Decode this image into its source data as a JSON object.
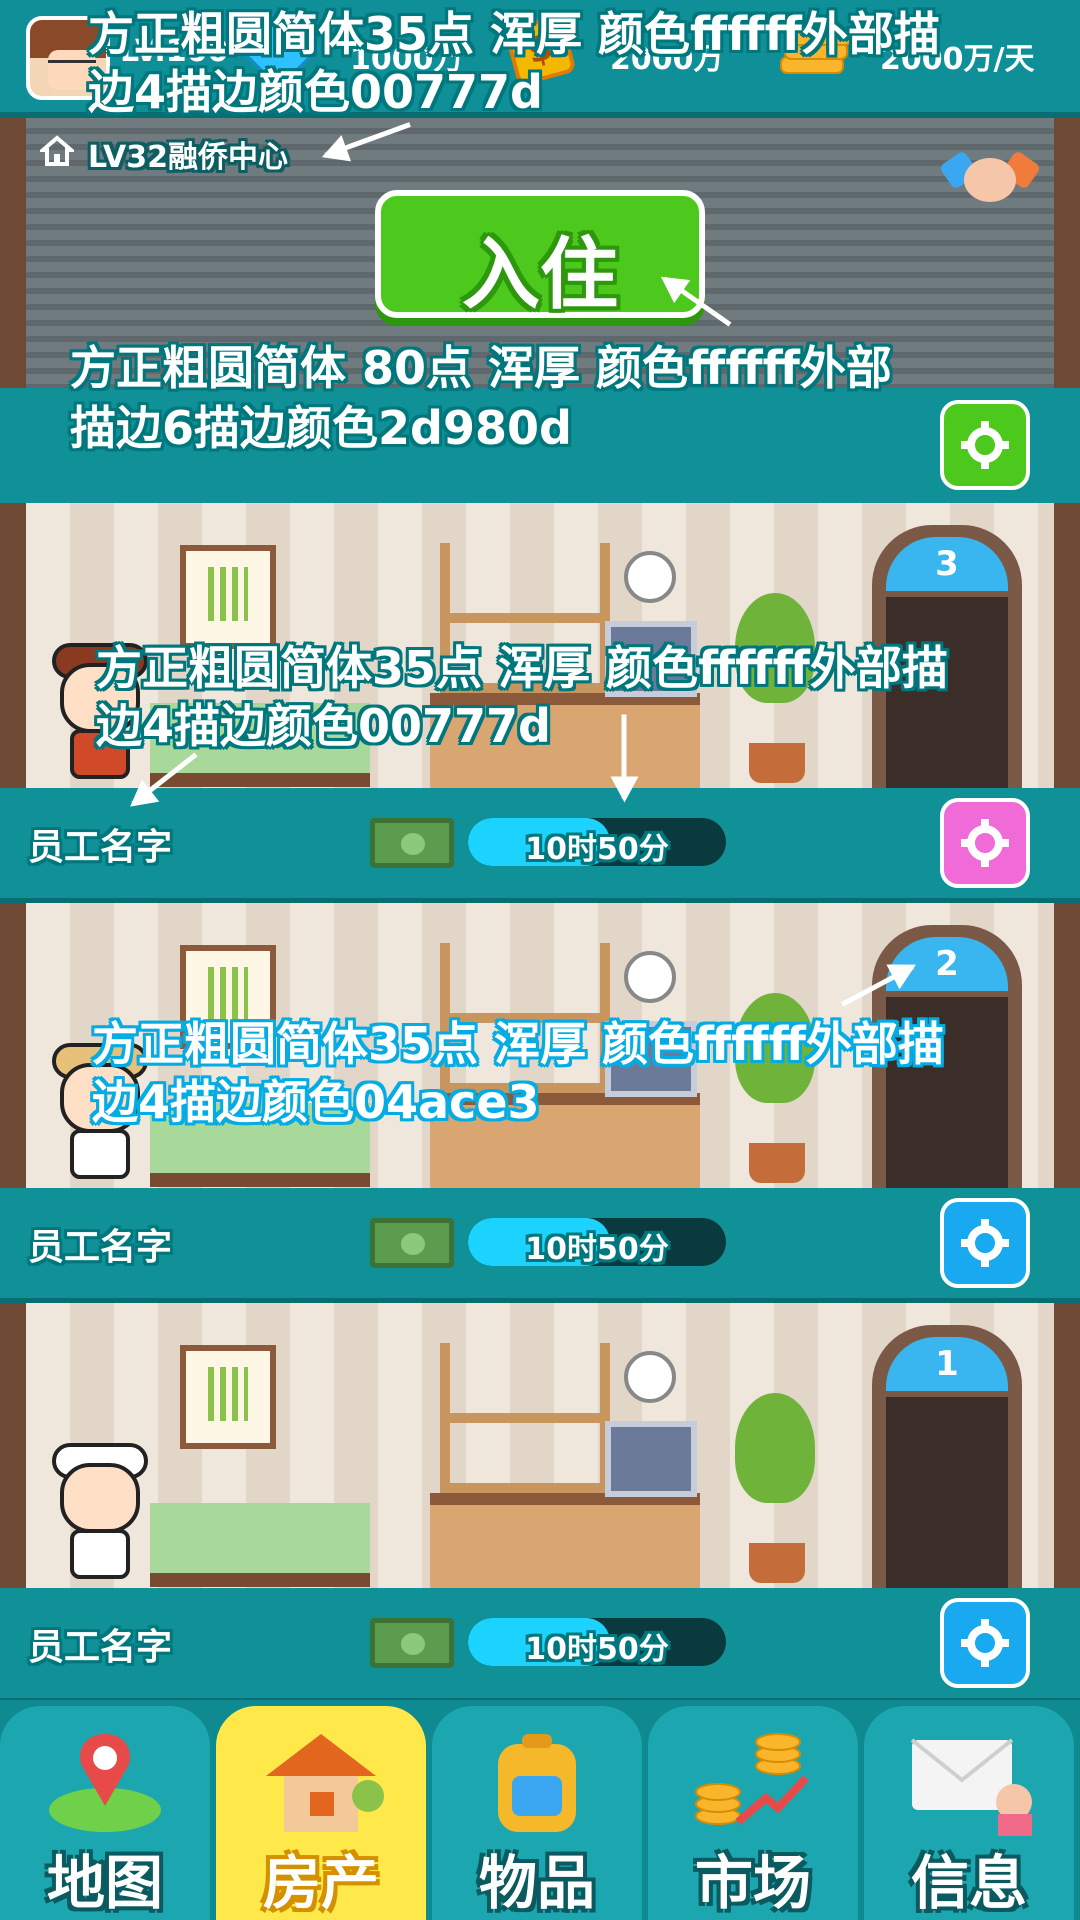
{
  "topbar": {
    "level_label": "LV.100",
    "stat1": "1000万",
    "stat2": "2000万",
    "stat3": "2000万/天"
  },
  "header": {
    "building_label": "LV32融侨中心",
    "enter_label": "入住"
  },
  "rooms": [
    {
      "door_number": "3",
      "staff_name": "员工名字",
      "timer": "10时50分",
      "progress": 0.55,
      "gear_color": "#f06ad8"
    },
    {
      "door_number": "2",
      "staff_name": "员工名字",
      "timer": "10时50分",
      "progress": 0.55,
      "gear_color": "#19a9f0"
    },
    {
      "door_number": "1",
      "staff_name": "员工名字",
      "timer": "10时50分",
      "progress": 0.55,
      "gear_color": "#19a9f0"
    }
  ],
  "annotations": {
    "top_line1": "方正粗圆简体35点    浑厚    颜色ffffff外部描",
    "top_line2": "边4描边颜色00777d",
    "enter_line1": "方正粗圆简体 80点    浑厚    颜色ffffff外部",
    "enter_line2": "描边6描边颜色2d980d",
    "room3_line1": "方正粗圆简体35点    浑厚    颜色ffffff外部描",
    "room3_line2": "边4描边颜色00777d",
    "room2_line1": "方正粗圆简体35点    浑厚    颜色ffffff外部描",
    "room2_line2": "边4描边颜色04ace3"
  },
  "nav": {
    "items": [
      {
        "label": "地图",
        "icon": "map-pin-icon",
        "active": false
      },
      {
        "label": "房产",
        "icon": "house-icon",
        "active": true
      },
      {
        "label": "物品",
        "icon": "backpack-icon",
        "active": false
      },
      {
        "label": "市场",
        "icon": "coins-chart-icon",
        "active": false
      },
      {
        "label": "信息",
        "icon": "mail-icon",
        "active": false
      }
    ]
  },
  "colors": {
    "teal": "#109097",
    "green_button": "#4cc91c",
    "outline_teal": "#00777d",
    "outline_green": "#2d980d",
    "outline_blue": "#04ace3"
  }
}
